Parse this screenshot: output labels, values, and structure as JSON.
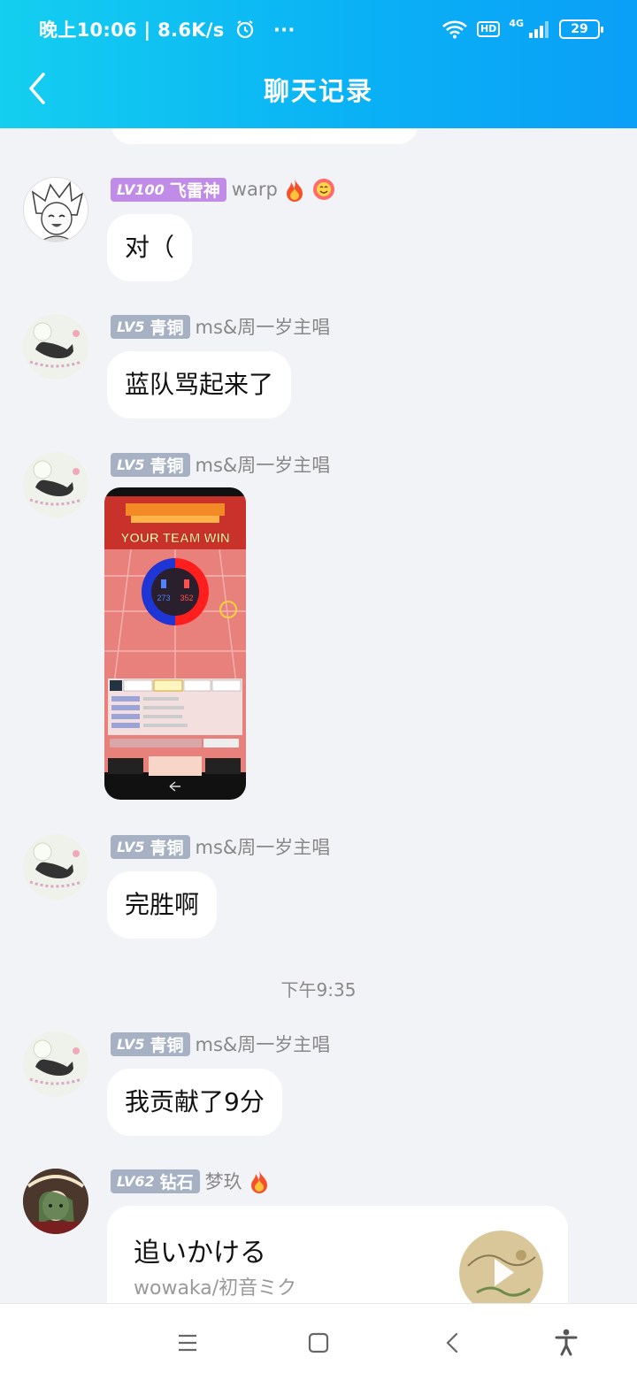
{
  "status_bar": {
    "time_speed": "晚上10:06 | 8.6K/s",
    "more": "···",
    "hd": "HD",
    "network": "4G",
    "battery": "29"
  },
  "header": {
    "title": "聊天记录"
  },
  "messages": [
    {
      "level": "LV100",
      "rank": "飞雷神",
      "nickname": "warp",
      "text": "对（"
    },
    {
      "level": "LV5",
      "rank": "青铜",
      "nickname": "ms&周一岁主唱",
      "text": "蓝队骂起来了"
    },
    {
      "level": "LV5",
      "rank": "青铜",
      "nickname": "ms&周一岁主唱",
      "image_text": "YOUR TEAM WIN",
      "blue_score": "273",
      "red_score": "352"
    },
    {
      "level": "LV5",
      "rank": "青铜",
      "nickname": "ms&周一岁主唱",
      "text": "完胜啊"
    },
    {
      "level": "LV5",
      "rank": "青铜",
      "nickname": "ms&周一岁主唱",
      "text": "我贡献了9分"
    },
    {
      "level": "LV62",
      "rank": "钻石",
      "nickname": "梦玖",
      "song_title": "追いかける",
      "song_artist": "wowaka/初音ミク"
    }
  ],
  "timestamp": "下午9:35",
  "colors": {
    "header_start": "#14cff0",
    "header_end": "#0a9ff7",
    "badge_purple": "#c18be8",
    "badge_gray": "#a6b2c4",
    "background": "#f2f3f7"
  },
  "icons": [
    "back-arrow-icon",
    "alarm-icon",
    "wifi-icon",
    "signal-icon",
    "fire-icon",
    "smiley-icon",
    "play-icon",
    "menu-icon",
    "home-icon",
    "nav-back-icon",
    "accessibility-icon"
  ]
}
